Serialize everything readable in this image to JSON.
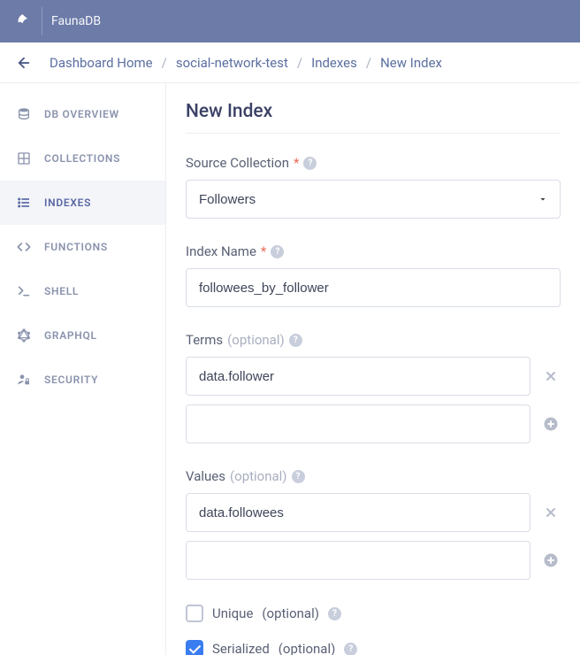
{
  "brand": "FaunaDB",
  "breadcrumb": {
    "items": [
      "Dashboard Home",
      "social-network-test",
      "Indexes",
      "New Index"
    ]
  },
  "sidebar": {
    "items": [
      {
        "label": "DB OVERVIEW"
      },
      {
        "label": "COLLECTIONS"
      },
      {
        "label": "INDEXES"
      },
      {
        "label": "FUNCTIONS"
      },
      {
        "label": "SHELL"
      },
      {
        "label": "GRAPHQL"
      },
      {
        "label": "SECURITY"
      }
    ],
    "activeIndex": 2
  },
  "page": {
    "title": "New Index",
    "source_label": "Source Collection",
    "source_value": "Followers",
    "name_label": "Index Name",
    "name_value": "followees_by_follower",
    "terms_label": "Terms",
    "optional_text": "(optional)",
    "terms": [
      "data.follower",
      ""
    ],
    "values_label": "Values",
    "values": [
      "data.followees",
      ""
    ],
    "unique_label": "Unique",
    "unique_checked": false,
    "serialized_label": "Serialized",
    "serialized_checked": true
  }
}
